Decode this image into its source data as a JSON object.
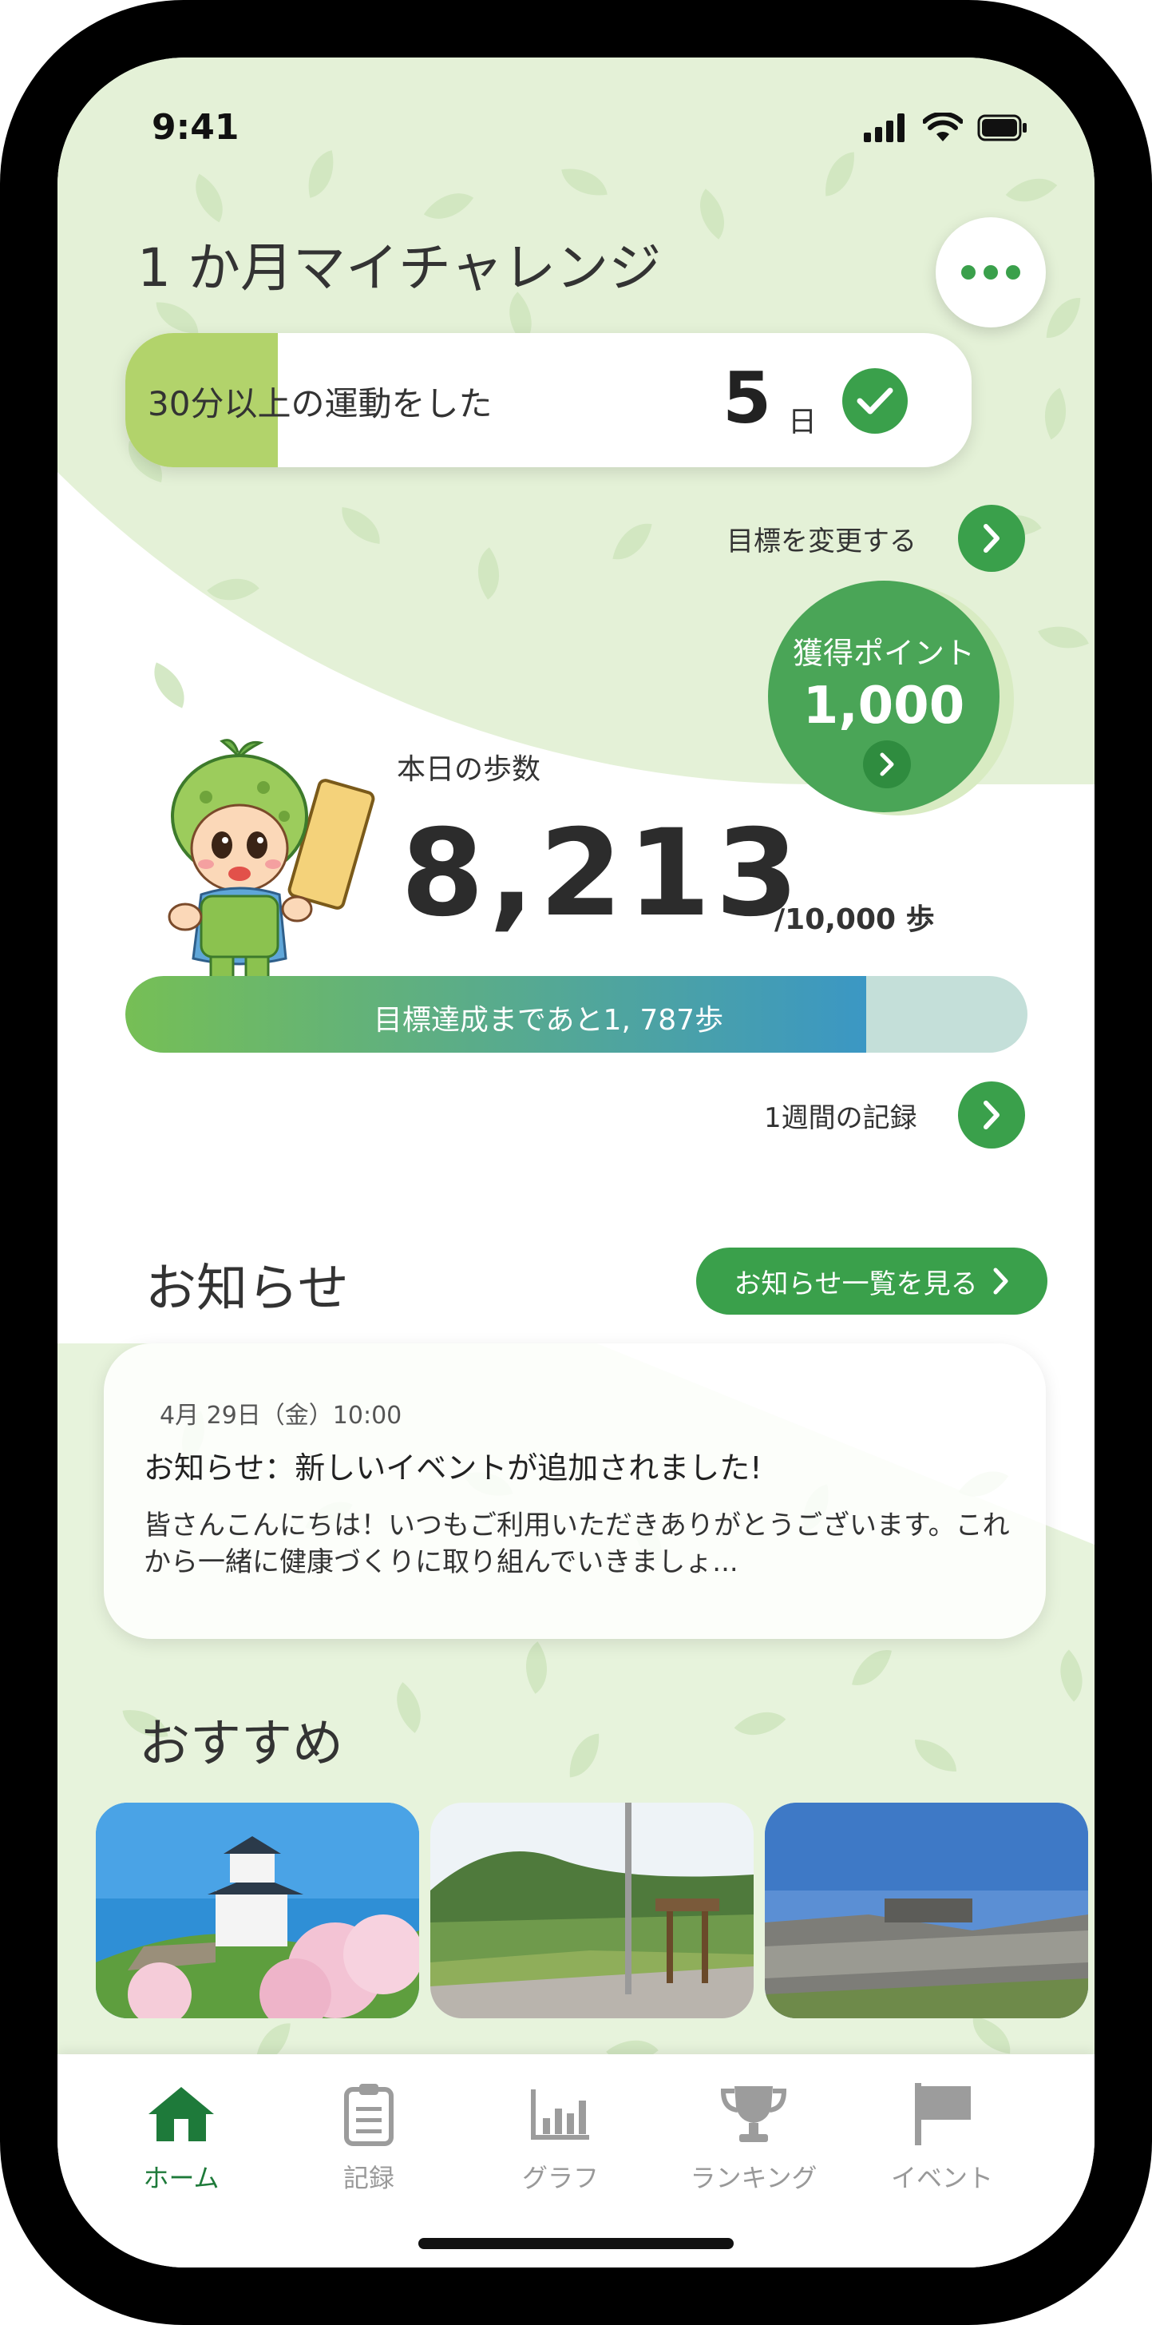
{
  "status_bar": {
    "time": "9:41"
  },
  "header": {
    "title": "1 か月マイチャレンジ",
    "more_icon": "more-dots-icon"
  },
  "challenge": {
    "label": "30分以上の運動をした",
    "days": "5",
    "days_unit": "日",
    "progress_fraction": 0.18
  },
  "change_goal": {
    "label": "目標を変更する"
  },
  "points": {
    "label": "獲得ポイント",
    "value": "1,000"
  },
  "steps": {
    "label": "本日の歩数",
    "value": "8,213",
    "goal": "/10,000 歩",
    "progress_fraction": 0.8213,
    "remaining_text": "目標達成まであと1, 787歩"
  },
  "weekly_record": {
    "label": "1週間の記録"
  },
  "notices": {
    "heading": "お知らせ",
    "view_all": "お知らせ一覧を見る",
    "item": {
      "date": "4月 29日（金）10:00",
      "title": "お知らせ：新しいイベントが追加されました!",
      "body": "皆さんこんにちは！いつもご利用いただきありがとうございます。これから一緒に健康づくりに取り組んでいきましょ..."
    }
  },
  "recommended": {
    "heading": "おすすめ"
  },
  "tabbar": {
    "items": [
      {
        "label": "ホーム",
        "icon": "home-icon",
        "active": true
      },
      {
        "label": "記録",
        "icon": "clipboard-icon",
        "active": false
      },
      {
        "label": "グラフ",
        "icon": "bar-chart-icon",
        "active": false
      },
      {
        "label": "ランキング",
        "icon": "trophy-icon",
        "active": false
      },
      {
        "label": "イベント",
        "icon": "flag-icon",
        "active": false
      }
    ]
  },
  "colors": {
    "accent": "#3aa04b",
    "challenge_fill": "#b2d36b",
    "background_green": "#e4f1d7"
  }
}
